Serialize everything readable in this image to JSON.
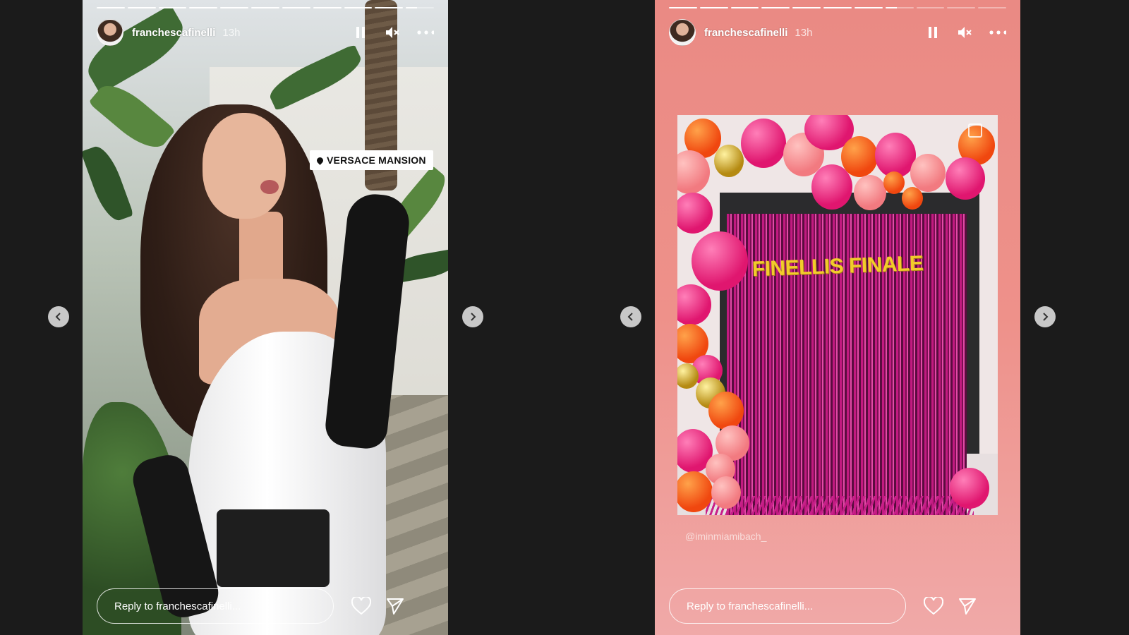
{
  "stories": [
    {
      "username": "franchescafinelli",
      "timestamp": "13h",
      "progress_segments": 11,
      "active_segment_index": 10,
      "location_sticker": "VERSACE MANSION",
      "reply_placeholder": "Reply to franchescafinelli..."
    },
    {
      "username": "franchescafinelli",
      "timestamp": "13h",
      "progress_segments": 11,
      "active_segment_index": 7,
      "photo_banner_text": "FINELLIS FINALE",
      "mention_text": "@iminmiamibach_",
      "reply_placeholder": "Reply to franchescafinelli..."
    }
  ],
  "icons": {
    "pause": "pause-icon",
    "mute": "muted-speaker-icon",
    "more": "more-options-icon",
    "like": "heart-icon",
    "share": "paper-plane-icon",
    "prev": "chevron-left-icon",
    "next": "chevron-right-icon"
  },
  "colors": {
    "page_background": "#1b1b1b",
    "story2_background": "#ee918a",
    "banner_text": "#f2cc2a",
    "curtain": "#c21a80"
  }
}
